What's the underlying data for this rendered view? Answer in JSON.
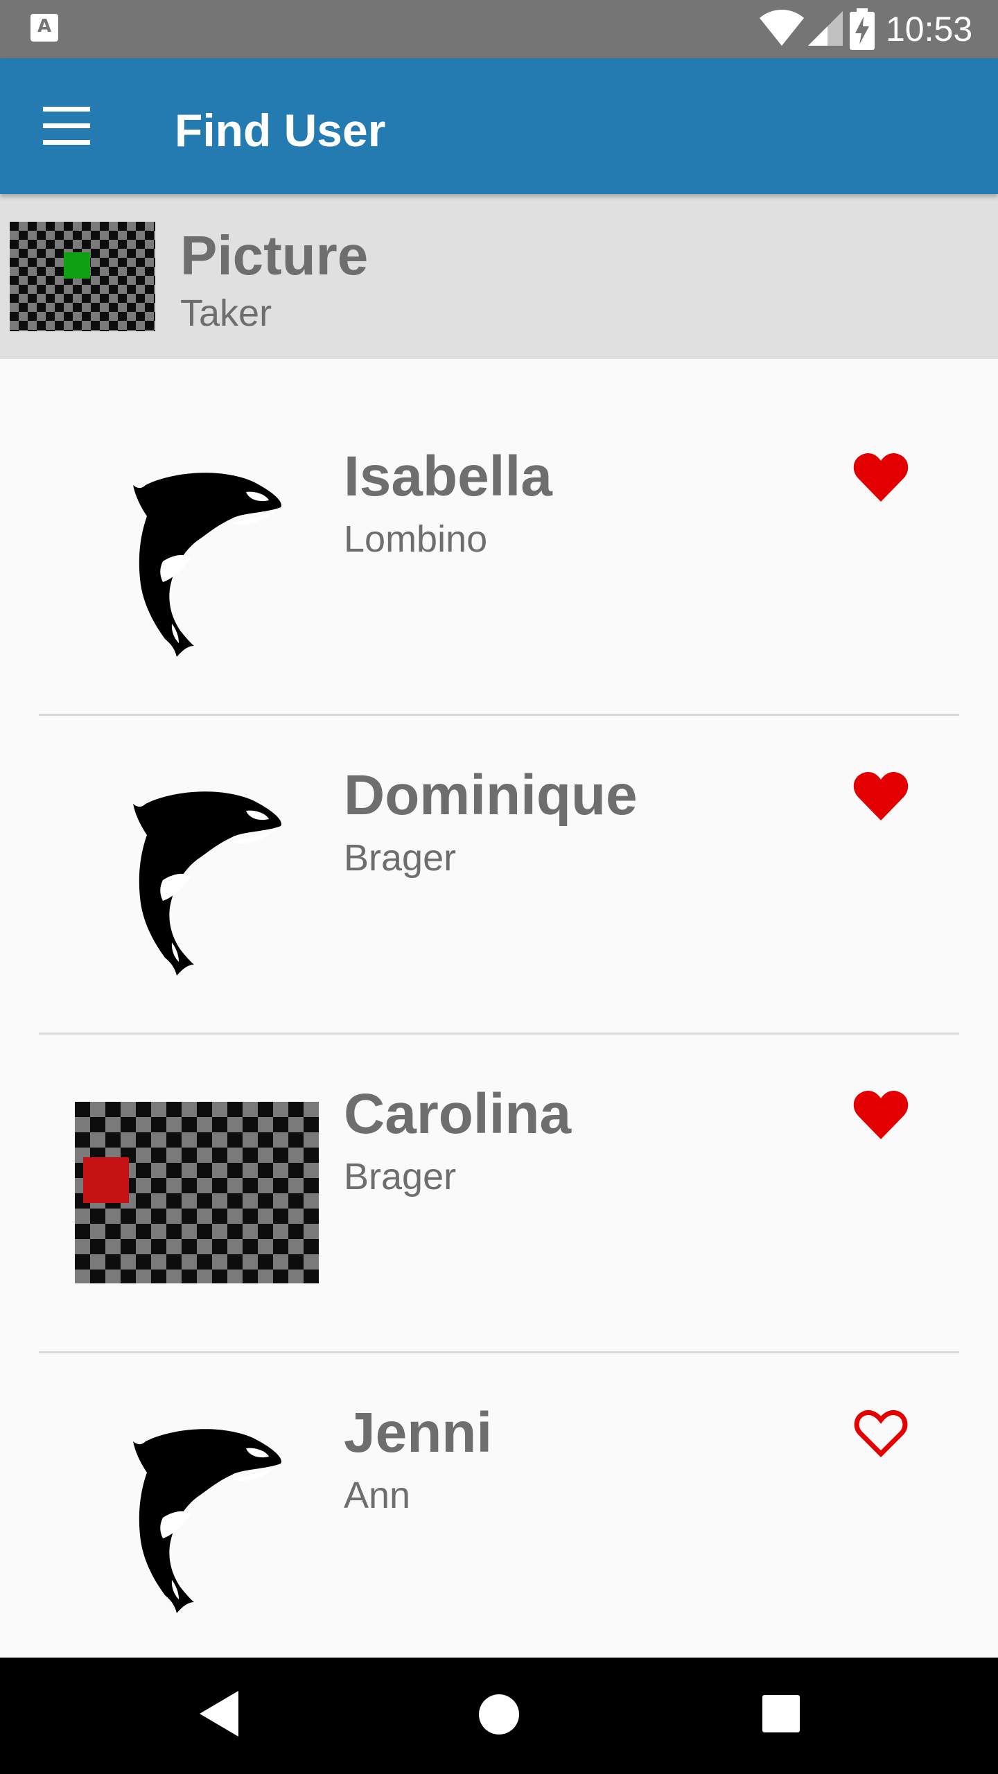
{
  "status_bar": {
    "time": "10:53",
    "left_icon_letter": "A",
    "icons": [
      "notification-a-icon",
      "wifi-icon",
      "signal-icon",
      "battery-charging-icon"
    ]
  },
  "app_bar": {
    "title": "Find User",
    "menu_icon": "hamburger-menu-icon",
    "background": "#247bb1"
  },
  "current_user": {
    "first_name": "Picture",
    "last_name": "Taker",
    "thumbnail": "checkerboard-green-square",
    "background": "#e0e0e0"
  },
  "users": [
    {
      "first_name": "Isabella",
      "last_name": "Lombino",
      "avatar": "orca-image",
      "favorite": true
    },
    {
      "first_name": "Dominique",
      "last_name": "Brager",
      "avatar": "orca-image",
      "favorite": true
    },
    {
      "first_name": "Carolina",
      "last_name": "Brager",
      "avatar": "checkerboard-red-square",
      "favorite": true
    },
    {
      "first_name": "Jenni",
      "last_name": "Ann",
      "avatar": "orca-image",
      "favorite": false
    }
  ],
  "colors": {
    "heart": "#e40000",
    "text": "#6e6e6e",
    "list_background": "#fafafa"
  },
  "nav_bar": {
    "icons": [
      "back-icon",
      "home-icon",
      "recents-icon"
    ]
  }
}
